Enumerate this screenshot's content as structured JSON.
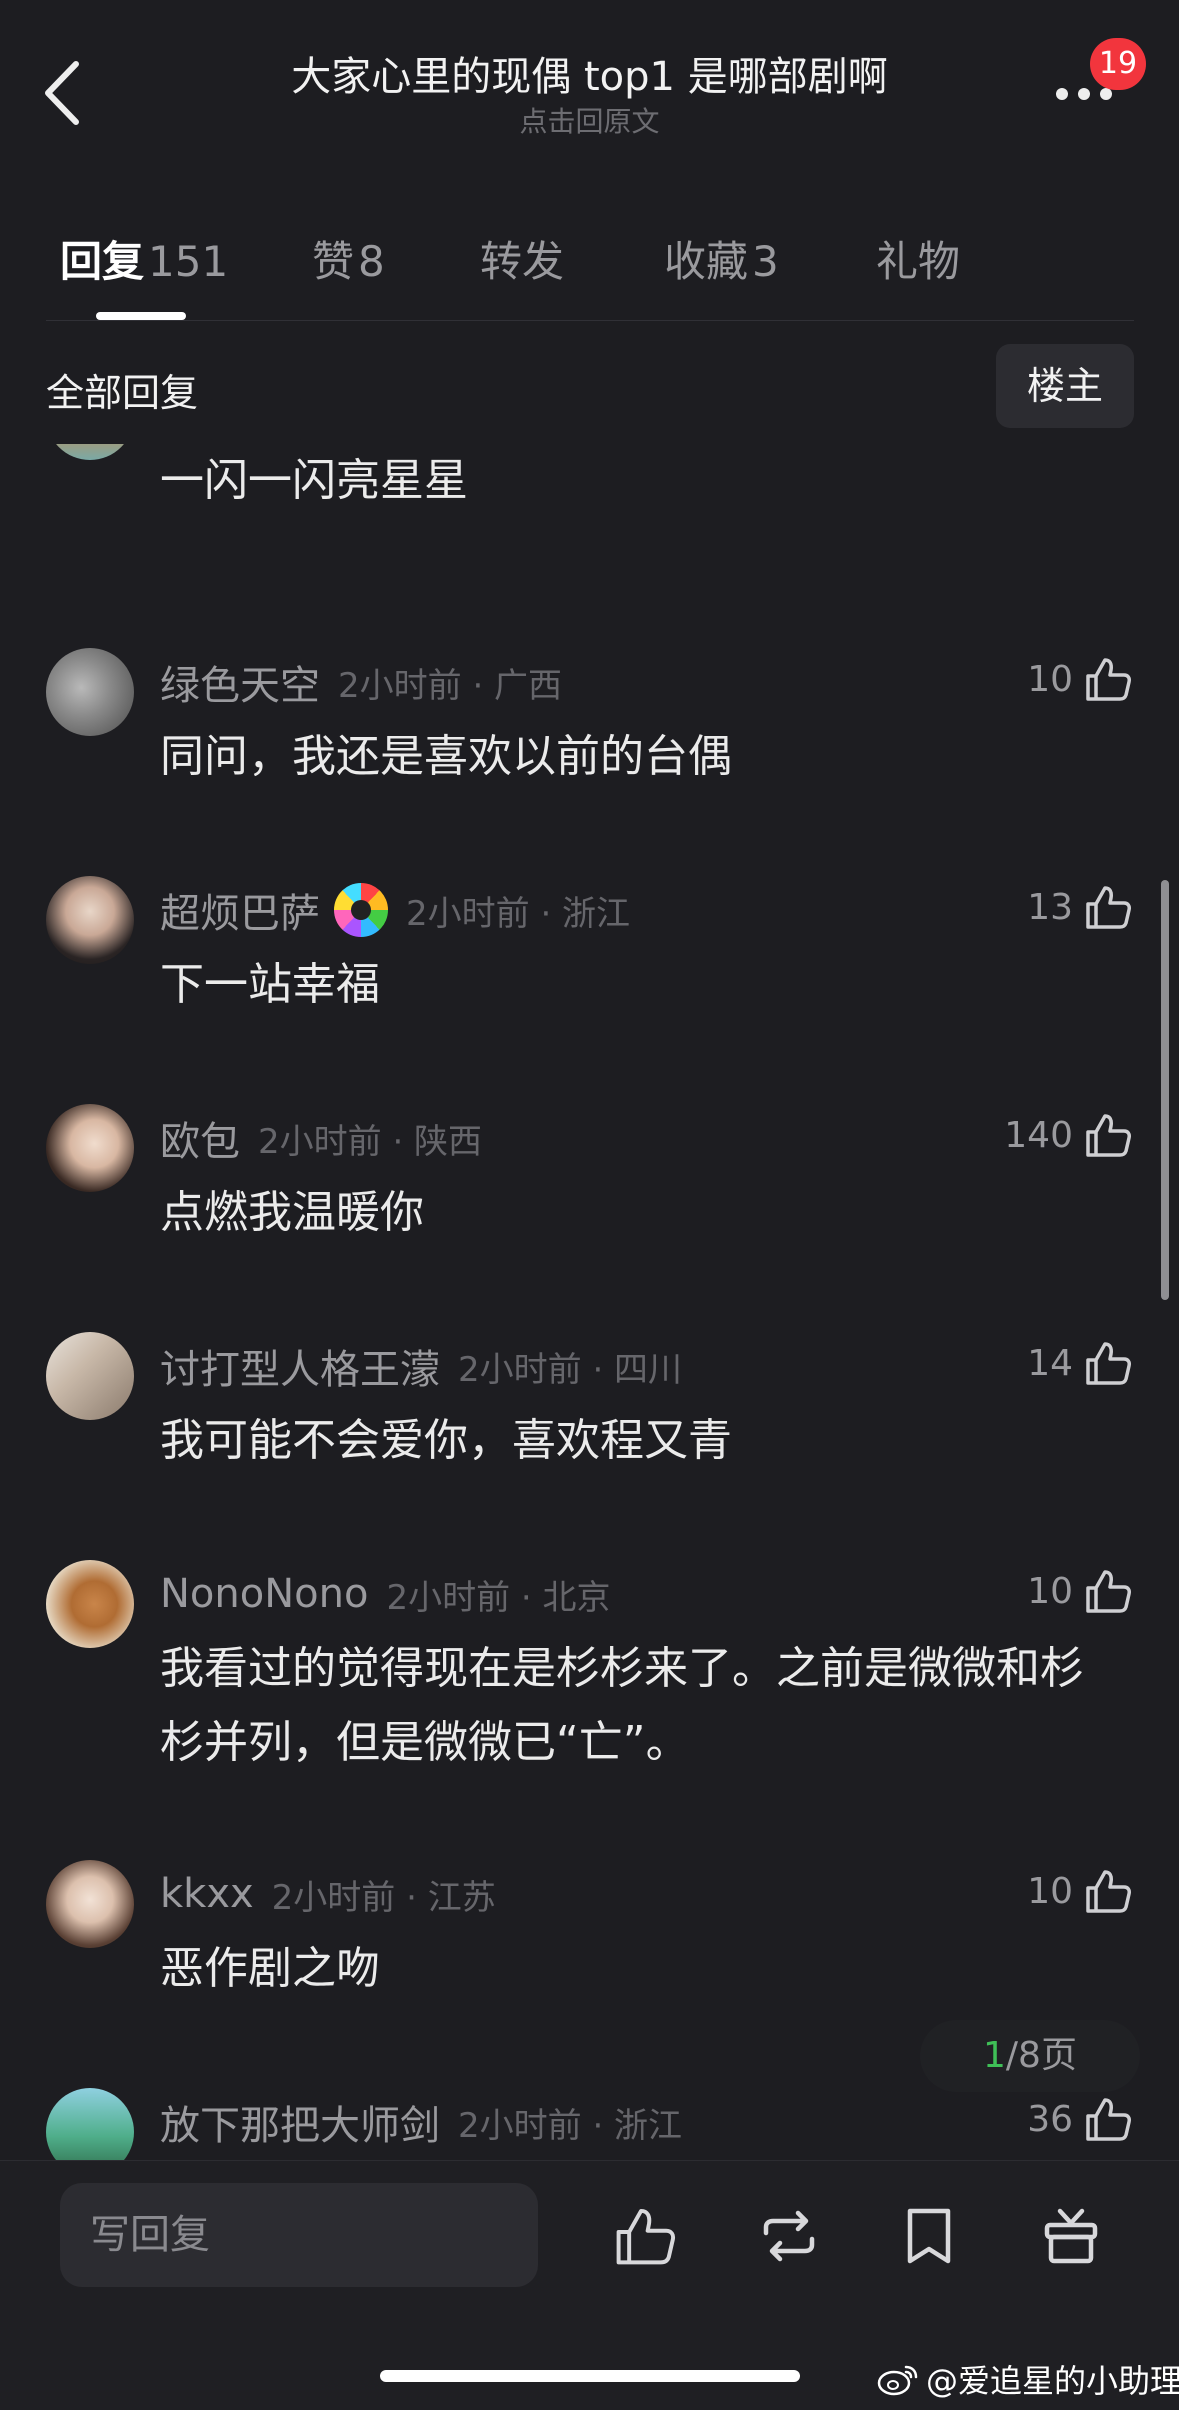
{
  "header": {
    "title": "大家心里的现偶 top1 是哪部剧啊",
    "subtitle": "点击回原文",
    "notification_badge": "19"
  },
  "tabs": [
    {
      "label": "回复",
      "count": "151",
      "active": true
    },
    {
      "label": "赞",
      "count": "8"
    },
    {
      "label": "转发",
      "count": ""
    },
    {
      "label": "收藏",
      "count": "3"
    },
    {
      "label": "礼物",
      "count": ""
    }
  ],
  "filter": {
    "title": "全部回复",
    "button": "楼主"
  },
  "comments": [
    {
      "username": "",
      "time_location": "",
      "likes": "",
      "text": "一闪一闪亮星星",
      "partial": true
    },
    {
      "username": "绿色天空",
      "time_location": "2小时前 · 广西",
      "likes": "10",
      "text": "同问，我还是喜欢以前的台偶"
    },
    {
      "username": "超烦巴萨",
      "time_location": "2小时前 · 浙江",
      "likes": "13",
      "text": "下一站幸福",
      "has_badge": true
    },
    {
      "username": "欧包",
      "time_location": "2小时前 · 陕西",
      "likes": "140",
      "text": "点燃我温暖你"
    },
    {
      "username": "讨打型人格王濛",
      "time_location": "2小时前 · 四川",
      "likes": "14",
      "text": "我可能不会爱你，喜欢程又青"
    },
    {
      "username": "NonoNono",
      "time_location": "2小时前 · 北京",
      "likes": "10",
      "text": "我看过的觉得现在是杉杉来了。之前是微微和杉杉并列，但是微微已“亡”。"
    },
    {
      "username": "kkxx",
      "time_location": "2小时前 · 江苏",
      "likes": "10",
      "text": "恶作剧之吻"
    },
    {
      "username": "放下那把大师剑",
      "time_location": "2小时前 · 浙江",
      "likes": "36",
      "text": ""
    }
  ],
  "pagination": {
    "current": "1",
    "total": "/8页"
  },
  "bottom_bar": {
    "reply_placeholder": "写回复"
  },
  "watermark": "@爱追星的小助理",
  "colors": {
    "background": "#1d1d21",
    "badge": "#f2353d",
    "page_current": "#3fbf57"
  }
}
